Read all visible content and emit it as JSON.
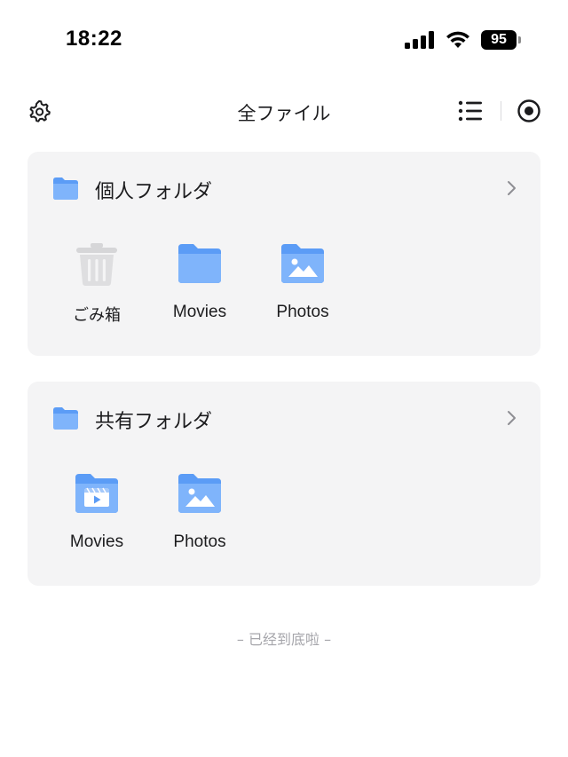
{
  "status_bar": {
    "time": "18:22",
    "battery": "95"
  },
  "header": {
    "title": "全ファイル",
    "icons": [
      "gear-icon",
      "list-icon",
      "target-icon"
    ]
  },
  "sections": [
    {
      "title": "個人フォルダ",
      "items": [
        {
          "label": "ごみ箱",
          "icon": "trash-icon"
        },
        {
          "label": "Movies",
          "icon": "folder-icon"
        },
        {
          "label": "Photos",
          "icon": "photo-folder-icon"
        }
      ]
    },
    {
      "title": "共有フォルダ",
      "items": [
        {
          "label": "Movies",
          "icon": "video-folder-icon"
        },
        {
          "label": "Photos",
          "icon": "photo-folder-icon"
        }
      ]
    }
  ],
  "footer": {
    "note": "– 已经到底啦 –"
  },
  "colors": {
    "folder": "#5b9cf6",
    "folder_light": "#7fb4fb",
    "card_bg": "#f4f4f5",
    "trash": "#d6d6d8",
    "muted_text": "#a6a6ab"
  }
}
